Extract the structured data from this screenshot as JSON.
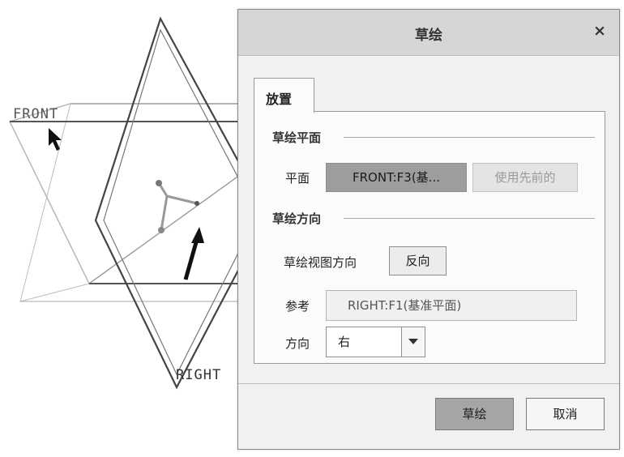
{
  "viewport": {
    "front_label": "FRONT",
    "right_label": "RIGHT"
  },
  "dialog": {
    "title": "草绘",
    "close_label": "×",
    "tab_label": "放置",
    "sketch_plane": {
      "section_title": "草绘平面",
      "plane_label": "平面",
      "plane_value": "FRONT:F3(基...",
      "use_previous_label": "使用先前的"
    },
    "sketch_orientation": {
      "section_title": "草绘方向",
      "view_direction_label": "草绘视图方向",
      "flip_label": "反向",
      "reference_label": "参考",
      "reference_value": "RIGHT:F1(基准平面)",
      "orientation_label": "方向",
      "orientation_value": "右"
    },
    "buttons": {
      "sketch": "草绘",
      "cancel": "取消"
    }
  }
}
